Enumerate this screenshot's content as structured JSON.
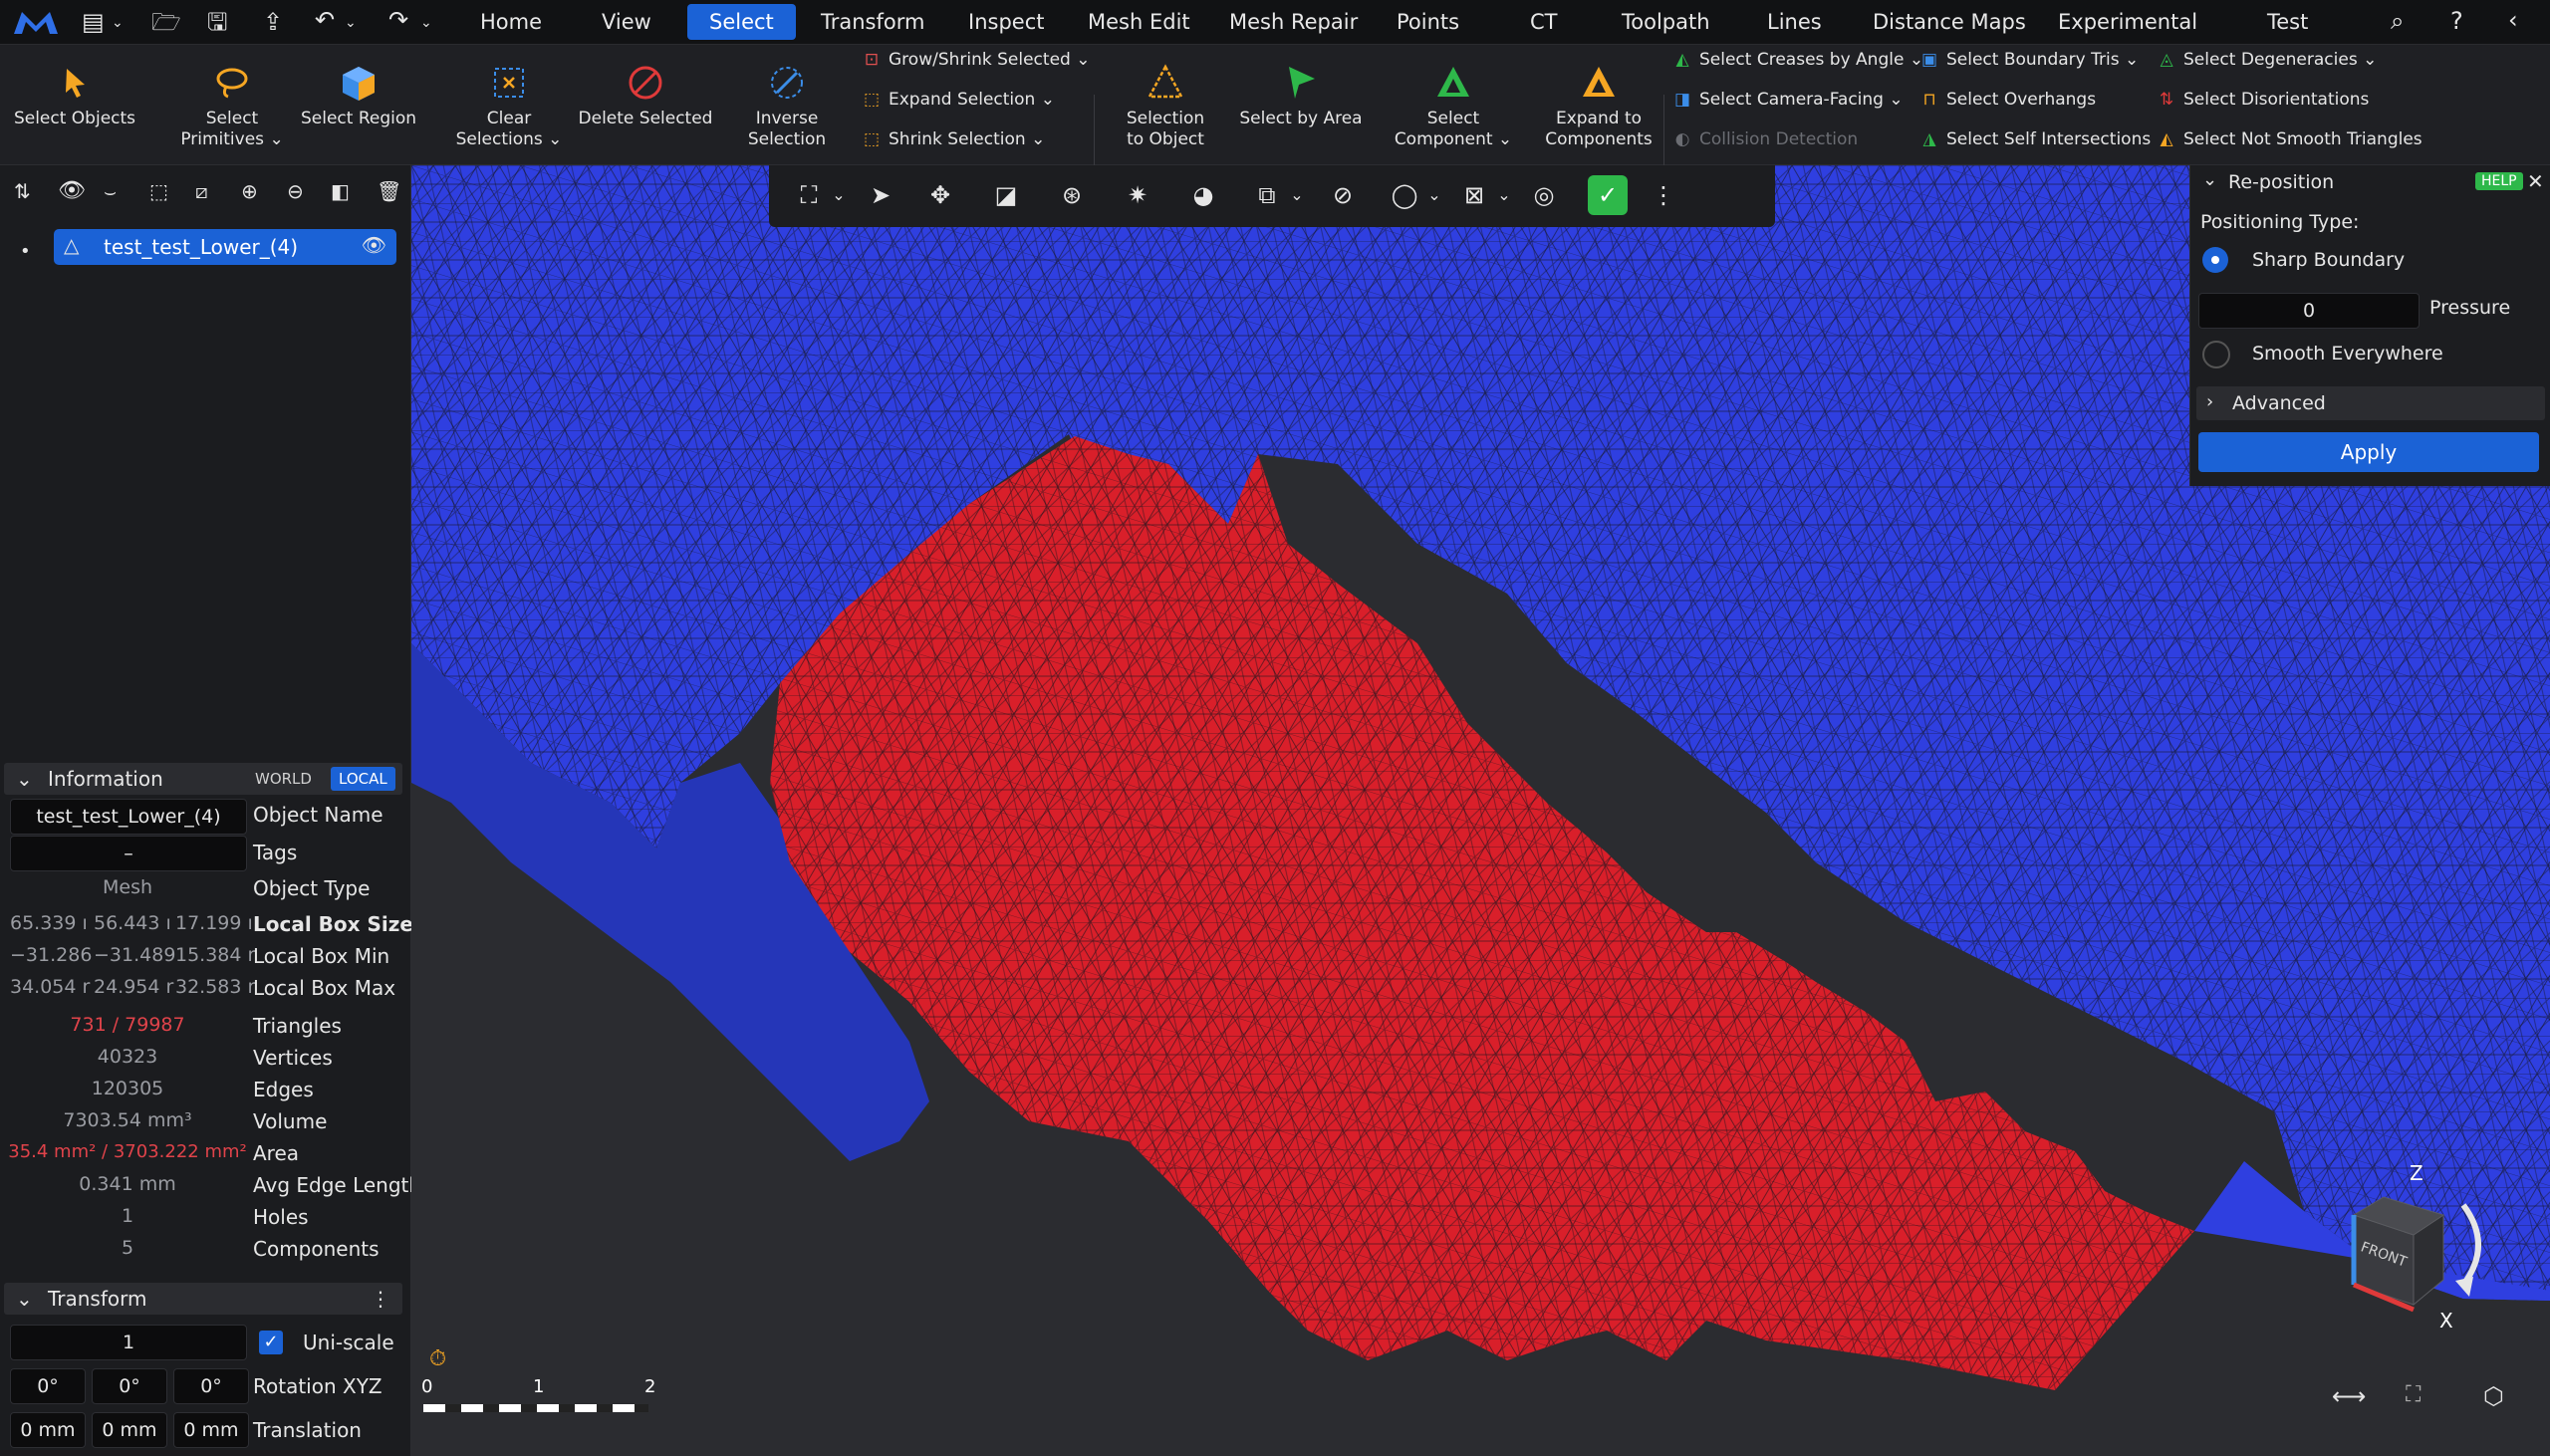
{
  "menu": {
    "tabs": [
      "Home",
      "View",
      "Select",
      "Transform",
      "Inspect",
      "Mesh Edit",
      "Mesh Repair",
      "Points",
      "CT",
      "Toolpath",
      "Lines",
      "Distance Maps",
      "Experimental",
      "Test"
    ],
    "active_tab": "Select"
  },
  "ribbon": {
    "select_objects": "Select Objects",
    "select_primitives": [
      "Select",
      "Primitives"
    ],
    "select_region": "Select Region",
    "clear_selections": [
      "Clear",
      "Selections"
    ],
    "delete_selected": "Delete Selected",
    "inverse_selection": [
      "Inverse",
      "Selection"
    ],
    "grow_shrink": "Grow/Shrink Selected",
    "expand_selection": "Expand Selection",
    "shrink_selection": "Shrink Selection",
    "selection_to_object": [
      "Selection",
      "to Object"
    ],
    "select_by_area": "Select by Area",
    "select_component": [
      "Select",
      "Component"
    ],
    "expand_to_components": [
      "Expand to",
      "Components"
    ],
    "creases": "Select Creases by Angle",
    "camera_facing": "Select Camera-Facing",
    "collision_detection": "Collision Detection",
    "boundary_tris": "Select Boundary Tris",
    "overhangs": "Select Overhangs",
    "self_intersections": "Select Self Intersections",
    "degeneracies": "Select Degeneracies",
    "disorientations": "Select Disorientations",
    "not_smooth": "Select Not Smooth Triangles"
  },
  "scene": {
    "object_name": "test_test_Lower_(4)"
  },
  "info": {
    "title": "Information",
    "world": "WORLD",
    "local": "LOCAL",
    "object_name_value": "test_test_Lower_(4)",
    "object_name_label": "Object Name",
    "tags_value": "–",
    "tags_label": "Tags",
    "type_value": "Mesh",
    "type_label": "Object Type",
    "box_size": [
      "65.339 ı",
      "56.443 ı",
      "17.199 ı"
    ],
    "box_size_label": "Local Box Size",
    "box_min": [
      "−31.286",
      "−31.489",
      "15.384 r"
    ],
    "box_min_label": "Local Box Min",
    "box_max": [
      "34.054 r",
      "24.954 r",
      "32.583 r"
    ],
    "box_max_label": "Local Box Max",
    "triangles_value": "731 / 79987",
    "triangles_label": "Triangles",
    "vertices_value": "40323",
    "vertices_label": "Vertices",
    "edges_value": "120305",
    "edges_label": "Edges",
    "volume_value": "7303.54 mm³",
    "volume_label": "Volume",
    "area_value": "35.4 mm² / 3703.222 mm²",
    "area_label": "Area",
    "avg_edge_value": "0.341 mm",
    "avg_edge_label": "Avg Edge Length",
    "holes_value": "1",
    "holes_label": "Holes",
    "components_value": "5",
    "components_label": "Components"
  },
  "transform": {
    "title": "Transform",
    "scale_value": "1",
    "uniscale_label": "Uni-scale",
    "rot": [
      "0°",
      "0°",
      "0°"
    ],
    "rot_label": "Rotation XYZ",
    "trans": [
      "0 mm",
      "0 mm",
      "0 mm"
    ],
    "trans_label": "Translation"
  },
  "reposition": {
    "title": "Re-position",
    "help": "HELP",
    "positioning_type": "Positioning Type:",
    "sharp_boundary": "Sharp Boundary",
    "pressure_value": "0",
    "pressure_label": "Pressure",
    "smooth_everywhere": "Smooth Everywhere",
    "advanced": "Advanced",
    "apply": "Apply"
  },
  "scale_bar": [
    "0",
    "1",
    "2"
  ],
  "gizmo": {
    "z": "Z",
    "x": "X",
    "face": "FRONT"
  },
  "colors": {
    "accent": "#1b62d6",
    "mesh_blue": "#2f3fe0",
    "mesh_red": "#d91f2a",
    "selected_text": "#e0434a"
  }
}
